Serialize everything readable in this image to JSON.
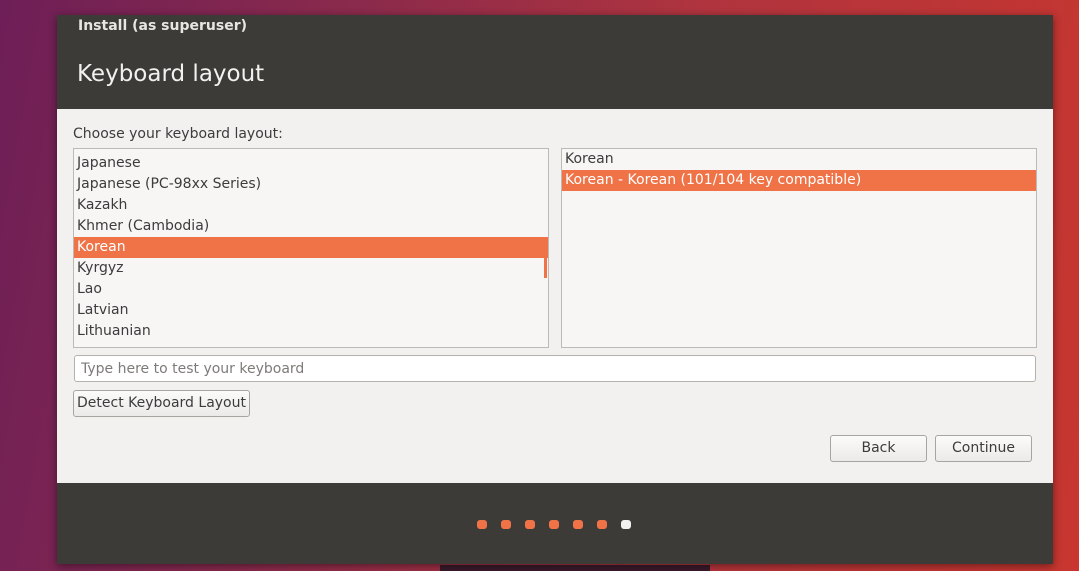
{
  "window": {
    "title": "Install (as superuser)",
    "page_title": "Keyboard layout"
  },
  "layout_prompt": "Choose your keyboard layout:",
  "layouts": [
    {
      "label": "Japanese",
      "selected": false
    },
    {
      "label": "Japanese (PC-98xx Series)",
      "selected": false
    },
    {
      "label": "Kazakh",
      "selected": false
    },
    {
      "label": "Khmer (Cambodia)",
      "selected": false
    },
    {
      "label": "Korean",
      "selected": true
    },
    {
      "label": "Kyrgyz",
      "selected": false
    },
    {
      "label": "Lao",
      "selected": false
    },
    {
      "label": "Latvian",
      "selected": false
    },
    {
      "label": "Lithuanian",
      "selected": false
    }
  ],
  "variants": [
    {
      "label": "Korean",
      "selected": false
    },
    {
      "label": "Korean - Korean (101/104 key compatible)",
      "selected": true
    }
  ],
  "test_input": {
    "value": "",
    "placeholder": "Type here to test your keyboard"
  },
  "buttons": {
    "detect": "Detect Keyboard Layout",
    "back": "Back",
    "continue": "Continue"
  },
  "progress": {
    "total_steps": 7,
    "current_step": 7
  },
  "colors": {
    "accent": "#ef7347",
    "header": "#3c3b37",
    "window_bg": "#f2f1f0"
  }
}
